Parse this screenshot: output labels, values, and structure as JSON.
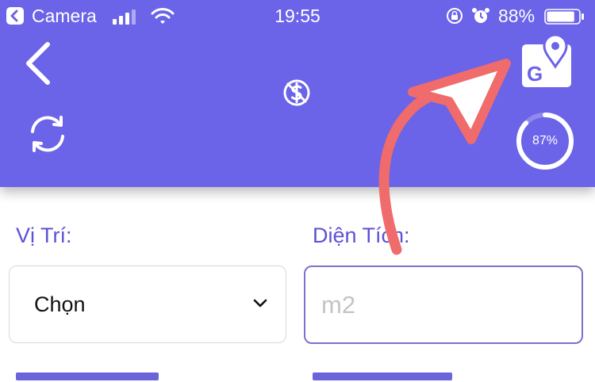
{
  "status_bar": {
    "back_app": "Camera",
    "time": "19:55",
    "battery": "88%",
    "battery_level": 0.88
  },
  "header": {
    "icons": [
      "back-arrow-icon",
      "no-dollar-icon",
      "refresh-icon",
      "google-maps-icon"
    ],
    "progress_value": 0.87,
    "progress_label": "87%",
    "accent_color": "#6b63e8"
  },
  "form": {
    "location_label": "Vị Trí:",
    "location_value": "Chọn",
    "area_label": "Diện Tích:",
    "area_placeholder": "m2"
  },
  "annotation": {
    "color": "#f06b6b",
    "shape": "curved-arrow-pointing-to-map-icon"
  }
}
